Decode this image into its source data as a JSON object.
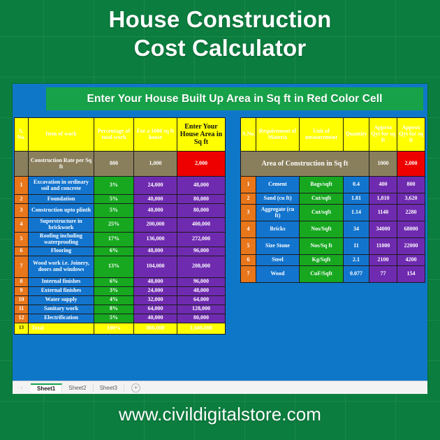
{
  "colors": {
    "backdrop_green": "#0b7d3e",
    "sheet_blue": "#0f77c8",
    "banner_green": "#17a24a",
    "header_yellow": "#ffff00",
    "header_text_red": "#a32020",
    "band_khaki": "#8a7f5c",
    "input_red": "#ef0000",
    "serial_orange": "#e8761b",
    "item_blue": "#1374ce",
    "pct_green": "#17a820",
    "value_purple": "#6f2bb0",
    "total_yellow": "#ffff00"
  },
  "title": {
    "line1": "House Construction",
    "line2": "Cost Calculator"
  },
  "banner": {
    "text": "Enter Your House Built Up Area in Sq ft in Red Color Cell"
  },
  "left_table": {
    "headers": [
      "S. No.",
      "Item of work",
      "Percentage of total work",
      "For a 1000 sq ft house",
      "Enter Your House Area in Sq ft"
    ],
    "rate_row": {
      "label": "Construction Rate per Sq ft",
      "percentage": "800",
      "for_1000": "1,000",
      "your_area": "2,000"
    },
    "rows": [
      {
        "sn": "1",
        "item": "Excavation in ordinary soil and concrete",
        "pct": "3%",
        "for_1000": "24,000",
        "your_area": "48,000"
      },
      {
        "sn": "2",
        "item": "Foundation",
        "pct": "5%",
        "for_1000": "40,000",
        "your_area": "80,000"
      },
      {
        "sn": "3",
        "item": "Construction upto plinth",
        "pct": "5%",
        "for_1000": "40,000",
        "your_area": "80,000"
      },
      {
        "sn": "4",
        "item": "Superstructure in brickwork",
        "pct": "25%",
        "for_1000": "200,000",
        "your_area": "400,000"
      },
      {
        "sn": "5",
        "item": "Roofing including waterproofing",
        "pct": "17%",
        "for_1000": "136,000",
        "your_area": "272,000"
      },
      {
        "sn": "6",
        "item": "Flooring",
        "pct": "6%",
        "for_1000": "48,000",
        "your_area": "96,000"
      },
      {
        "sn": "7",
        "item": "Wood work i.e. Joinery, doors and windows",
        "pct": "13%",
        "for_1000": "104,000",
        "your_area": "208,000"
      },
      {
        "sn": "8",
        "item": "Internal finishes",
        "pct": "6%",
        "for_1000": "48,000",
        "your_area": "96,000"
      },
      {
        "sn": "9",
        "item": "External finishes",
        "pct": "3%",
        "for_1000": "24,000",
        "your_area": "48,000"
      },
      {
        "sn": "10",
        "item": "Water supply",
        "pct": "4%",
        "for_1000": "32,000",
        "your_area": "64,000"
      },
      {
        "sn": "11",
        "item": "Sanitary work",
        "pct": "8%",
        "for_1000": "64,000",
        "your_area": "128,000"
      },
      {
        "sn": "12",
        "item": "Electrification",
        "pct": "5%",
        "for_1000": "40,000",
        "your_area": "80,000"
      }
    ],
    "total_row": {
      "sn": "13",
      "item": "Total",
      "pct": "100%",
      "for_1000": "800,000",
      "your_area": "1,600,000"
    }
  },
  "right_table": {
    "headers": [
      "S.No.",
      "Requirement of Materia",
      "Unit of measurement",
      "Quantity",
      "Approx Qyt for sq ft",
      "Approx Qyt for sq ft"
    ],
    "area_row": {
      "label": "Area of Construction in Sq ft",
      "base": "1000",
      "target": "2,000"
    },
    "rows": [
      {
        "sn": "1",
        "material": "Cement",
        "unit": "Bags/sqft",
        "qty": "0.4",
        "approx_base": "400",
        "approx_target": "800"
      },
      {
        "sn": "2",
        "material": "Sand (cu ft)",
        "unit": "Cut/sqft",
        "qty": "1.81",
        "approx_base": "1,810",
        "approx_target": "3,620"
      },
      {
        "sn": "3",
        "material": "Aggregate (cu ft)",
        "unit": "Cut/sqft",
        "qty": "1.14",
        "approx_base": "1140",
        "approx_target": "2280"
      },
      {
        "sn": "4",
        "material": "Bricks",
        "unit": "Nos/Sqft",
        "qty": "34",
        "approx_base": "34000",
        "approx_target": "68000"
      },
      {
        "sn": "5",
        "material": "Size Stone",
        "unit": "Nos/Sq ft",
        "qty": "11",
        "approx_base": "11000",
        "approx_target": "22000"
      },
      {
        "sn": "6",
        "material": "Steel",
        "unit": "Kg/Sqft",
        "qty": "2.1",
        "approx_base": "2100",
        "approx_target": "4200"
      },
      {
        "sn": "7",
        "material": "Wood",
        "unit": "CuF/Sqft",
        "qty": "0.077",
        "approx_base": "77",
        "approx_target": "154"
      }
    ]
  },
  "tabs": {
    "nav_glyph": "‹",
    "items": [
      {
        "label": "Sheet1",
        "active": true
      },
      {
        "label": "Sheet2",
        "active": false
      },
      {
        "label": "Sheet3",
        "active": false
      }
    ],
    "add_glyph": "+"
  },
  "footer": {
    "url": "www.civildigitalstore.com"
  }
}
